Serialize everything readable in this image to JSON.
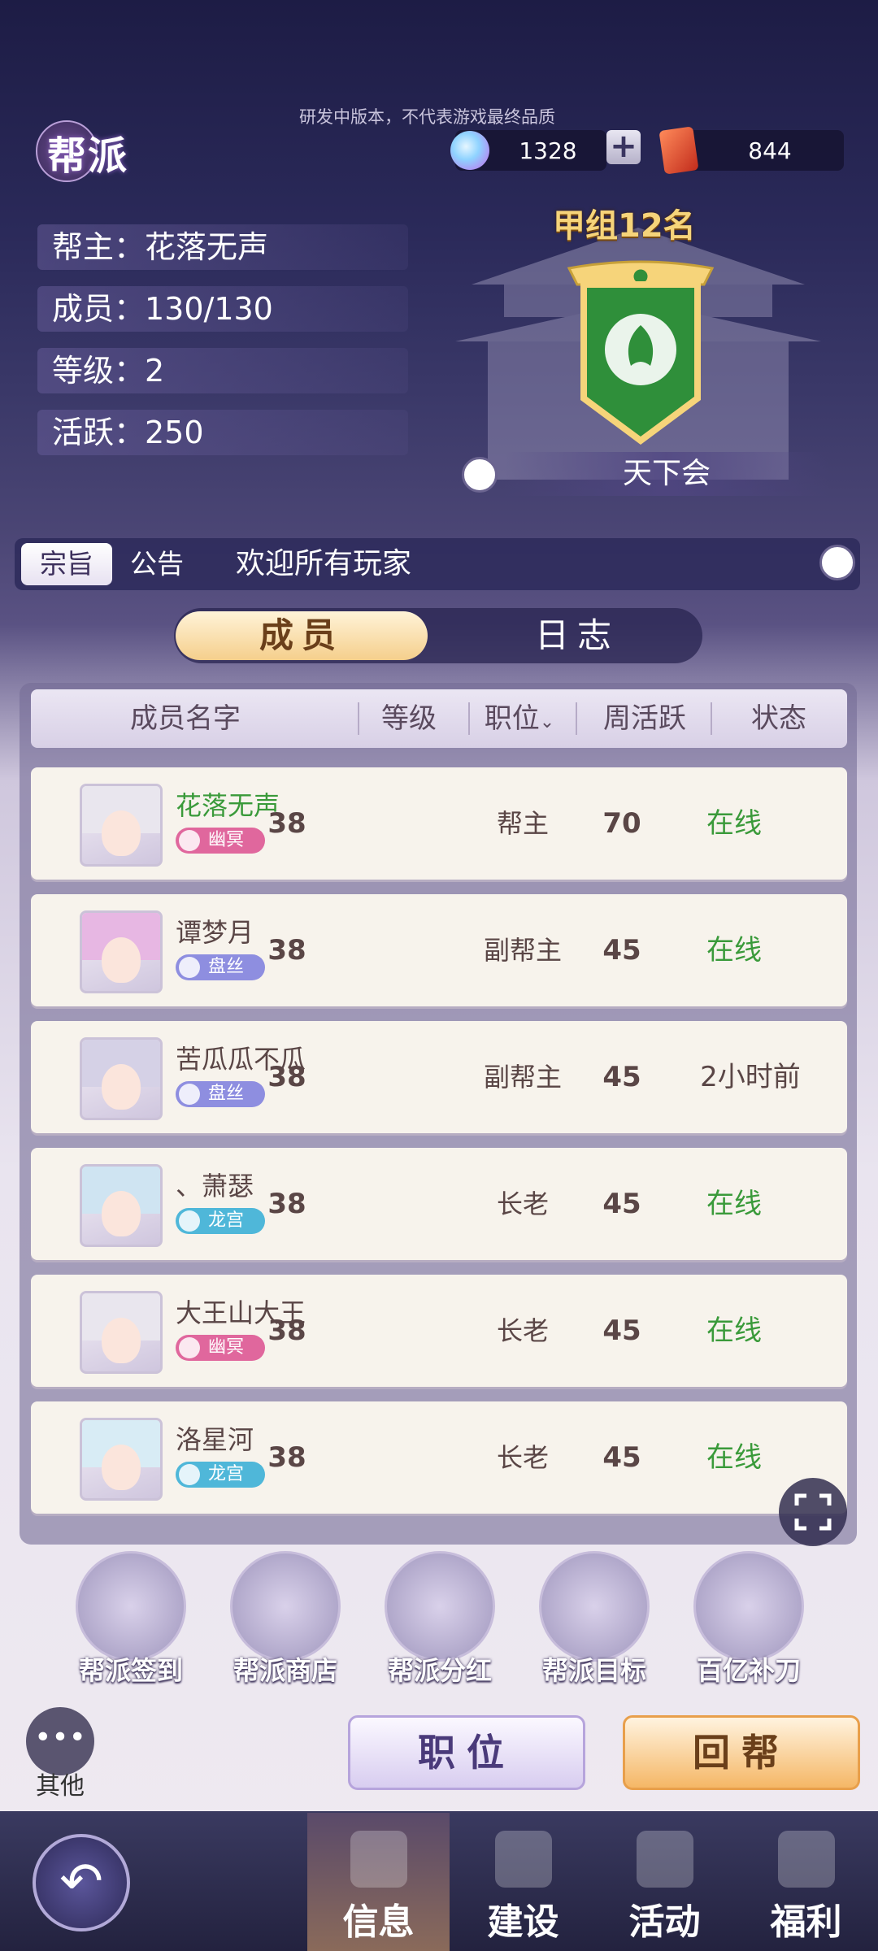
{
  "header": {
    "title": "帮派",
    "disclaimer": "研发中版本，不代表游戏最终品质",
    "currency1": "1328",
    "currency2": "844"
  },
  "guild_info": {
    "leader": "帮主：花落无声",
    "members": "成员：130/130",
    "level": "等级：2",
    "activity": "活跃：250"
  },
  "guild_rank": "甲组12名",
  "guild_name": "天下会",
  "purpose": {
    "tab_purpose": "宗旨",
    "tab_notice": "公告",
    "text": "欢迎所有玩家"
  },
  "toggle": {
    "members": "成员",
    "log": "日志"
  },
  "table": {
    "headers": [
      "成员名字",
      "等级",
      "职位",
      "周活跃",
      "状态"
    ],
    "rows": [
      {
        "name": "花落无声",
        "sect": "幽冥",
        "level": "38",
        "position": "帮主",
        "weekly": "70",
        "status": "在线"
      },
      {
        "name": "谭梦月",
        "sect": "盘丝",
        "level": "38",
        "position": "副帮主",
        "weekly": "45",
        "status": "在线"
      },
      {
        "name": "苦瓜瓜不瓜",
        "sect": "盘丝",
        "level": "38",
        "position": "副帮主",
        "weekly": "45",
        "status": "2小时前"
      },
      {
        "name": "、萧瑟",
        "sect": "龙宫",
        "level": "38",
        "position": "长老",
        "weekly": "45",
        "status": "在线"
      },
      {
        "name": "大王山大王",
        "sect": "幽冥",
        "level": "38",
        "position": "长老",
        "weekly": "45",
        "status": "在线"
      },
      {
        "name": "洛星河",
        "sect": "龙宫",
        "level": "38",
        "position": "长老",
        "weekly": "45",
        "status": "在线"
      }
    ]
  },
  "functions": [
    "帮派签到",
    "帮派商店",
    "帮派分红",
    "帮派目标",
    "百亿补刀"
  ],
  "other_label": "其他",
  "buttons": {
    "position": "职位",
    "return": "回帮"
  },
  "nav": [
    "信息",
    "建设",
    "活动",
    "福利"
  ],
  "colors": {
    "online": "#3a9a3a",
    "leader_name": "#3a9a3a",
    "rank_gold": "#f6d47a"
  }
}
